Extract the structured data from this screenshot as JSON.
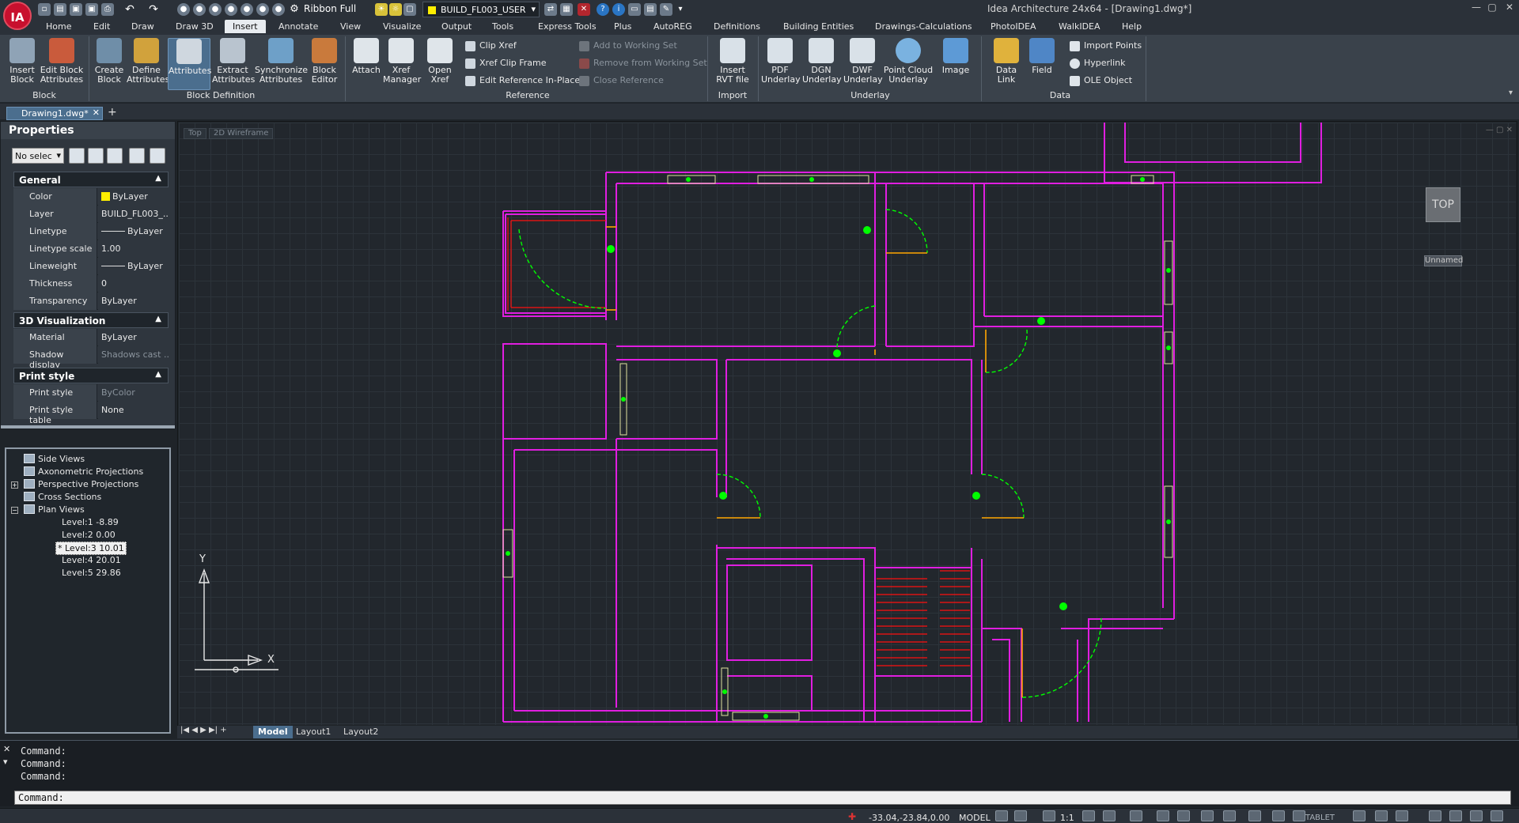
{
  "app": {
    "title": "Idea Architecture 24x64 - [Drawing1.dwg*]",
    "logo_text": "IA",
    "ribbon_mode": "Ribbon Full",
    "current_layer": "BUILD_FL003_USER",
    "colors": {
      "accent": "#4b6e8e",
      "layer_color": "#ffee00",
      "wall": "#e01ee0",
      "door": "#00ff00",
      "stair": "#ff1010",
      "frame": "#ffa500"
    }
  },
  "menu": {
    "tabs": [
      "Home",
      "Edit",
      "Draw",
      "Draw 3D",
      "Insert",
      "Annotate",
      "View",
      "Visualize",
      "Output",
      "Tools",
      "Express Tools",
      "Plus",
      "AutoREG",
      "Definitions",
      "Building Entities",
      "Drawings-Calculations",
      "PhotoIDEA",
      "WalkIDEA",
      "Help"
    ],
    "active": "Insert"
  },
  "ribbon": {
    "block": {
      "label": "Block",
      "insert": "Insert\nBlock",
      "edit_attr": "Edit Block\nAttributes"
    },
    "block_def": {
      "label": "Block Definition",
      "create": "Create\nBlock",
      "define": "Define\nAttributes",
      "attributes": "Attributes",
      "extract": "Extract\nAttributes",
      "sync": "Synchronize\nAttributes",
      "editor": "Block\nEditor"
    },
    "reference": {
      "label": "Reference",
      "attach": "Attach",
      "xref_mgr": "Xref\nManager",
      "open_xref": "Open\nXref",
      "clip_xref": "Clip Xref",
      "xref_clip_frame": "Xref Clip Frame",
      "edit_ref": "Edit Reference In-Place",
      "add_ws": "Add to Working Set",
      "remove_ws": "Remove from Working Set",
      "close_ref": "Close Reference"
    },
    "import": {
      "label": "Import",
      "rvt": "Insert\nRVT file"
    },
    "underlay": {
      "label": "Underlay",
      "pdf": "PDF\nUnderlay",
      "dgn": "DGN\nUnderlay",
      "dwf": "DWF\nUnderlay",
      "cloud": "Point Cloud\nUnderlay",
      "image": "Image"
    },
    "data": {
      "label": "Data",
      "link": "Data\nLink",
      "field": "Field",
      "import_points": "Import Points",
      "hyperlink": "Hyperlink",
      "ole": "OLE Object"
    }
  },
  "doc_tab": "Drawing1.dwg*",
  "properties": {
    "title": "Properties",
    "selection": "No selec",
    "general": {
      "label": "General",
      "rows": [
        {
          "k": "Color",
          "v": "ByLayer"
        },
        {
          "k": "Layer",
          "v": "BUILD_FL003_..."
        },
        {
          "k": "Linetype",
          "v": "ByLayer"
        },
        {
          "k": "Linetype scale",
          "v": "1.00"
        },
        {
          "k": "Lineweight",
          "v": "ByLayer"
        },
        {
          "k": "Thickness",
          "v": "0"
        },
        {
          "k": "Transparency",
          "v": "ByLayer"
        }
      ]
    },
    "vis3d": {
      "label": "3D Visualization",
      "rows": [
        {
          "k": "Material",
          "v": "ByLayer"
        },
        {
          "k": "Shadow display",
          "v": "Shadows cast ..."
        }
      ]
    },
    "print": {
      "label": "Print style",
      "rows": [
        {
          "k": "Print style",
          "v": "ByColor"
        },
        {
          "k": "Print style table",
          "v": "None"
        }
      ]
    }
  },
  "tree": {
    "items": [
      "Side Views",
      "Axonometric Projections",
      "Perspective Projections",
      "Cross Sections",
      "Plan Views"
    ],
    "levels": [
      "Level:1  -8.89",
      "Level:2  0.00",
      "* Level:3  10.01",
      "Level:4  20.01",
      "Level:5  29.86"
    ]
  },
  "viewport": {
    "view": "Top",
    "style": "2D Wireframe",
    "cube": "TOP",
    "ucs": "Unnamed",
    "axis_x": "X",
    "axis_y": "Y"
  },
  "layouts": [
    "Model",
    "Layout1",
    "Layout2"
  ],
  "command": {
    "history": [
      "Command:",
      "Command:",
      "Command:"
    ],
    "prompt": "Command:"
  },
  "status": {
    "coords": "-33.04,-23.84,0.00",
    "space": "MODEL",
    "scale": "1:1",
    "tablet": "TABLET"
  }
}
